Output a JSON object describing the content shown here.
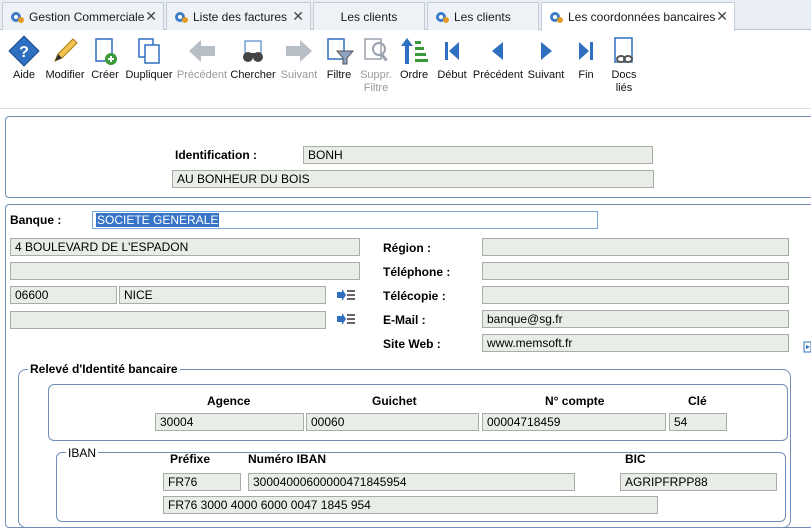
{
  "tabs": [
    {
      "label": "Gestion Commerciale",
      "active": false
    },
    {
      "label": "Liste des factures",
      "active": false
    },
    {
      "label": "Les clients",
      "active": false
    },
    {
      "label": "Les clients",
      "active": false
    },
    {
      "label": "Les coordonnées bancaires",
      "active": true
    }
  ],
  "close_glyph": "✕",
  "toolbar": {
    "aide": "Aide",
    "modifier": "Modifier",
    "creer": "Créer",
    "dupliquer": "Dupliquer",
    "precedent_disabled": "Précédent",
    "chercher": "Chercher",
    "suivant_disabled": "Suivant",
    "filtre": "Filtre",
    "suppr_filtre_1": "Suppr.",
    "suppr_filtre_2": "Filtre",
    "ordre": "Ordre",
    "debut": "Début",
    "precedent": "Précédent",
    "suivant": "Suivant",
    "fin": "Fin",
    "docs_1": "Docs",
    "docs_2": "liés"
  },
  "identification": {
    "label": "Identification :",
    "code": "BONH",
    "name": "AU BONHEUR DU BOIS"
  },
  "banque": {
    "label": "Banque :",
    "value": "SOCIETE GENERALE",
    "address1": "4 BOULEVARD DE L'ESPADON",
    "address2": "",
    "postal_code": "06600",
    "city": "NICE",
    "country": "",
    "region_label": "Région :",
    "region": "",
    "telephone_label": "Téléphone :",
    "telephone": "",
    "telecopie_label": "Télécopie :",
    "telecopie": "",
    "email_label": "E-Mail :",
    "email": "banque@sg.fr",
    "site_label": "Site Web :",
    "site": "www.memsoft.fr"
  },
  "rib": {
    "title": "Relevé d'Identité bancaire",
    "agence_label": "Agence",
    "guichet_label": "Guichet",
    "compte_label": "N° compte",
    "cle_label": "Clé",
    "agence": "30004",
    "guichet": "00060",
    "compte": "00004718459",
    "cle": "54"
  },
  "iban": {
    "title": "IBAN",
    "prefixe_label": "Préfixe",
    "numero_label": "Numéro IBAN",
    "bic_label": "BIC",
    "prefixe": "FR76",
    "numero": "30004000600000471845954",
    "bic": "AGRIPFRPP88",
    "full": "FR76  3000  4000  6000  0047  1845  954"
  },
  "colors": {
    "panel_border": "#6f8fb6",
    "field_bg": "#e9ede7",
    "selection": "#3874c8",
    "icon_blue": "#2f6fbf",
    "icon_green": "#3a9a3a"
  }
}
